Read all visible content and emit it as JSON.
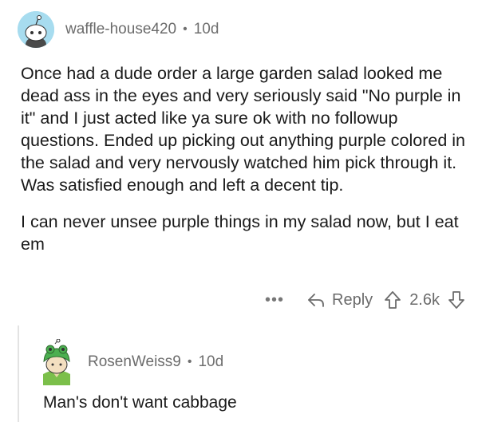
{
  "comment": {
    "username": "waffle-house420",
    "separator": "•",
    "age": "10d",
    "paragraphs": [
      "Once had a dude order a large garden salad looked me dead ass in the eyes and very seriously said \"No purple in it\" and I just acted like ya sure ok with no followup questions. Ended up picking out anything purple colored in the salad and very nervously watched him pick through it. Was satisfied enough and left a decent tip.",
      "I can never unsee purple things in my salad now, but I eat em"
    ],
    "actions": {
      "more": "•••",
      "reply_label": "Reply",
      "vote_count": "2.6k"
    }
  },
  "reply": {
    "username": "RosenWeiss9",
    "separator": "•",
    "age": "10d",
    "text": "Man's don't want cabbage"
  },
  "colors": {
    "avatar_bg": "#a7dcef",
    "meta_text": "#6f6f6f",
    "thread_line": "#e3e3e3"
  },
  "icons": [
    "snoo-avatar-icon",
    "reply-arrow-icon",
    "upvote-icon",
    "downvote-icon",
    "frog-hat-avatar-icon"
  ]
}
